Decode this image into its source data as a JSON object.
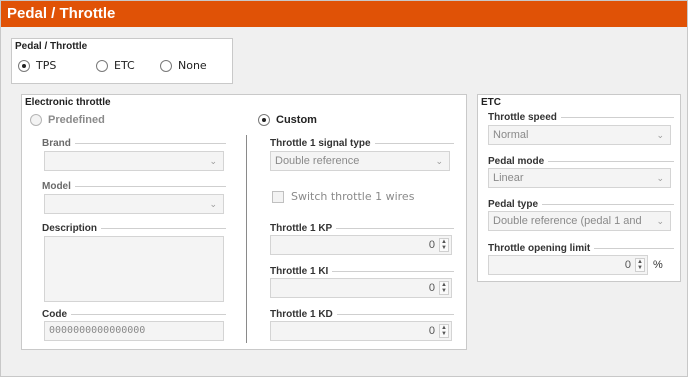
{
  "window": {
    "title": "Pedal / Throttle"
  },
  "pedal_group": {
    "title": "Pedal / Throttle",
    "options": [
      {
        "label": "TPS",
        "selected": true
      },
      {
        "label": "ETC",
        "selected": false
      },
      {
        "label": "None",
        "selected": false
      }
    ]
  },
  "electronic": {
    "title": "Electronic throttle",
    "predefined": {
      "label": "Predefined",
      "brand_label": "Brand",
      "brand_value": "",
      "model_label": "Model",
      "model_value": "",
      "description_label": "Description",
      "code_label": "Code",
      "code_value": "0000000000000000"
    },
    "custom": {
      "label": "Custom",
      "signal_type_label": "Throttle 1 signal type",
      "signal_type_value": "Double reference",
      "switch_label": "Switch throttle 1 wires",
      "kp_label": "Throttle 1 KP",
      "kp_value": "0",
      "ki_label": "Throttle 1 KI",
      "ki_value": "0",
      "kd_label": "Throttle 1 KD",
      "kd_value": "0"
    }
  },
  "etc": {
    "title": "ETC",
    "speed_label": "Throttle speed",
    "speed_value": "Normal",
    "pedal_mode_label": "Pedal mode",
    "pedal_mode_value": "Linear",
    "pedal_type_label": "Pedal type",
    "pedal_type_value": "Double reference (pedal 1 and",
    "opening_label": "Throttle opening limit",
    "opening_value": "0",
    "opening_unit": "%"
  }
}
